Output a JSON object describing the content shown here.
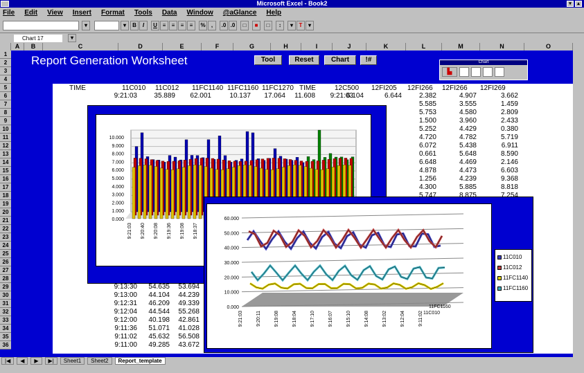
{
  "window": {
    "title": "Microsoft Excel - Book2"
  },
  "menu": [
    "File",
    "Edit",
    "View",
    "Insert",
    "Format",
    "Tools",
    "Data",
    "Window",
    "@aGlance",
    "Help"
  ],
  "namebox": "Chart 17",
  "columns": [
    "A",
    "B",
    "C",
    "D",
    "E",
    "F",
    "G",
    "H",
    "I",
    "J",
    "K",
    "L",
    "M",
    "N",
    "O"
  ],
  "rows": [
    "1",
    "2",
    "3",
    "4",
    "5",
    "6",
    "7",
    "8",
    "9",
    "10",
    "11",
    "12",
    "13",
    "14",
    "15",
    "16",
    "17",
    "18",
    "19",
    "20",
    "21",
    "22",
    "23",
    "24",
    "25",
    "26",
    "27",
    "28",
    "29",
    "30",
    "31",
    "32",
    "33",
    "34",
    "35",
    "36"
  ],
  "sheet": {
    "title": "Report Generation Worksheet",
    "buttons": [
      "Tool",
      "Reset",
      "Chart",
      "!#"
    ]
  },
  "palette": {
    "title": "Chart"
  },
  "headers": [
    "TIME",
    "11C010",
    "11C012",
    "11FC1140",
    "11FC1160",
    "11FC1270",
    "TIME",
    "12C500",
    "12FI205",
    "12FI266",
    "12FI266",
    "12FI269"
  ],
  "row5": [
    "9:21:03",
    "35.889",
    "62.001",
    "10.137",
    "17.064",
    "11.608",
    "9:21:03",
    "6.104",
    "6.644",
    "2.382",
    "4.907",
    "3.662"
  ],
  "right_cols": [
    [
      "5.585",
      "3.555",
      "1.459"
    ],
    [
      "5.753",
      "4.580",
      "2.809"
    ],
    [
      "1.500",
      "3.960",
      "2.433"
    ],
    [
      "5.252",
      "4.429",
      "0.380"
    ],
    [
      "4.720",
      "4.782",
      "5.719"
    ],
    [
      "6.072",
      "5.438",
      "6.911"
    ],
    [
      "0.661",
      "5.648",
      "8.590"
    ],
    [
      "6.648",
      "4.469",
      "2.146"
    ],
    [
      "4.878",
      "4.473",
      "6.603"
    ],
    [
      "1.256",
      "4.239",
      "9.368"
    ],
    [
      "4.300",
      "5.885",
      "8.818"
    ],
    [
      "5.747",
      "8.875",
      "7.254"
    ]
  ],
  "left_rows": [
    [
      "9:13:30",
      "54.635",
      "53.694"
    ],
    [
      "9:13:00",
      "44.104",
      "44.239"
    ],
    [
      "9:12:31",
      "46.209",
      "49.339"
    ],
    [
      "9:12:04",
      "44.544",
      "55.268"
    ],
    [
      "9:12:00",
      "40.198",
      "42.861"
    ],
    [
      "9:11:36",
      "51.071",
      "41.028"
    ],
    [
      "9:11:02",
      "45.632",
      "56.508"
    ],
    [
      "9:11:00",
      "49.285",
      "43.672"
    ]
  ],
  "bar_chart": {
    "y_ticks": [
      "10.000",
      "9.000",
      "8.000",
      "7.000",
      "6.000",
      "5.000",
      "4.000",
      "3.000",
      "2.000",
      "1.000",
      "0.000"
    ],
    "x_ticks": [
      "9:21:03",
      "9:20:40",
      "9:20:08",
      "9:19:36",
      "9:19:08",
      "9:18:37",
      "9:18:08",
      "9:17:38"
    ]
  },
  "line_chart": {
    "y_ticks": [
      "60.000",
      "50.000",
      "40.000",
      "30.000",
      "20.000",
      "10.000",
      "0.000"
    ],
    "x_ticks": [
      "9:21:03",
      "9:20:11",
      "9:19:08",
      "9:18:04",
      "9:17:10",
      "9:16:07",
      "9:15:10",
      "9:14:08",
      "9:13:02",
      "9:12:04",
      "9:11:02"
    ],
    "series_labels": [
      "11FC1160",
      "11C010"
    ],
    "legend": [
      "11C010",
      "11C012",
      "11FC1140",
      "11FC1160"
    ]
  },
  "tabs": [
    "Sheet1",
    "Sheet2",
    "Report_template"
  ]
}
